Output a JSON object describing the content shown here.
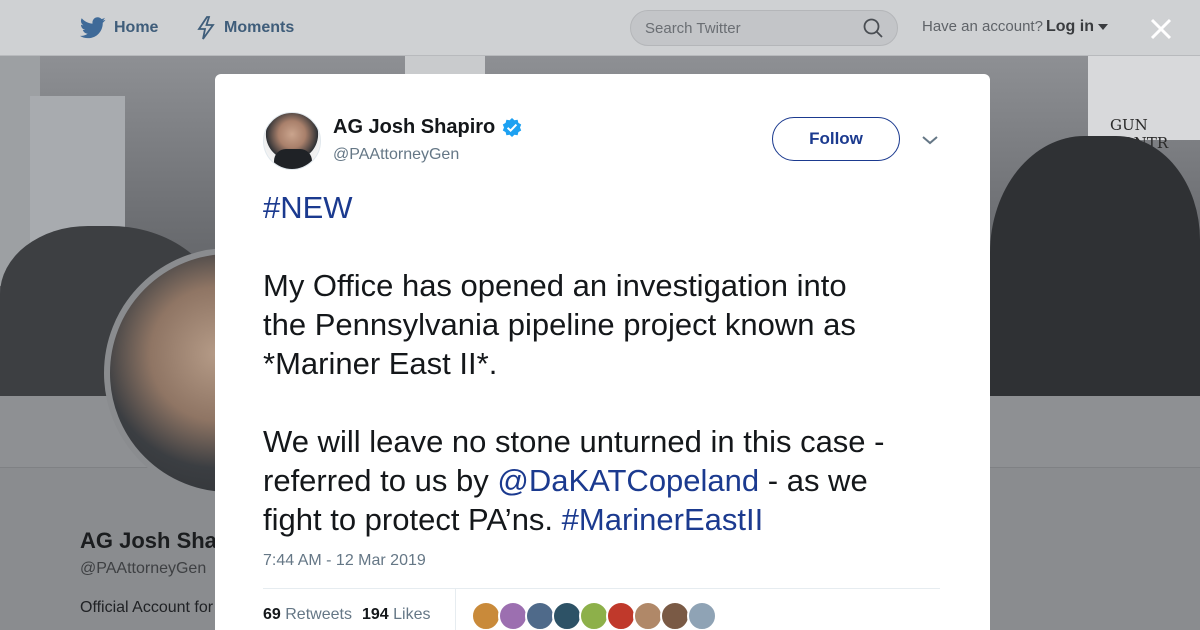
{
  "nav": {
    "home_label": "Home",
    "moments_label": "Moments",
    "search_placeholder": "Search Twitter",
    "account_prompt": "Have an account?",
    "login_label": "Log in"
  },
  "background_profile": {
    "sign_text": "GUN CONTR",
    "name": "AG Josh Shapiro",
    "handle": "@PAAttorneyGen",
    "bio": "Official Account for"
  },
  "tweet": {
    "author_name": "AG Josh Shapiro",
    "author_handle": "@PAAttorneyGen",
    "verified": true,
    "follow_label": "Follow",
    "hashtag_new": "#NEW",
    "para1_line1": "My Office has opened an investigation into",
    "para1_line2": "the Pennsylvania pipeline project known as",
    "para1_line3": "*Mariner East II*.",
    "para2_line1": "We will leave no stone unturned in this case -",
    "para2_line2_pre": "referred to us by ",
    "mention": "@DaKATCopeland",
    "para2_line2_post": " - as we",
    "para2_line3_pre": "fight to protect PA’ns. ",
    "hashtag_end": "#MarinerEastII",
    "timestamp": "7:44 AM - 12 Mar 2019",
    "retweets_count": "69",
    "retweets_label": "Retweets",
    "likes_count": "194",
    "likes_label": "Likes"
  },
  "colors": {
    "link": "#1b3a8f",
    "verified": "#1da1f2",
    "muted": "#657786"
  },
  "likers": [
    "#c98a3a",
    "#9c6fb0",
    "#4f6a8a",
    "#2d5266",
    "#8db04a",
    "#c0392b",
    "#b08868",
    "#7a5a45",
    "#8fa3b5"
  ]
}
